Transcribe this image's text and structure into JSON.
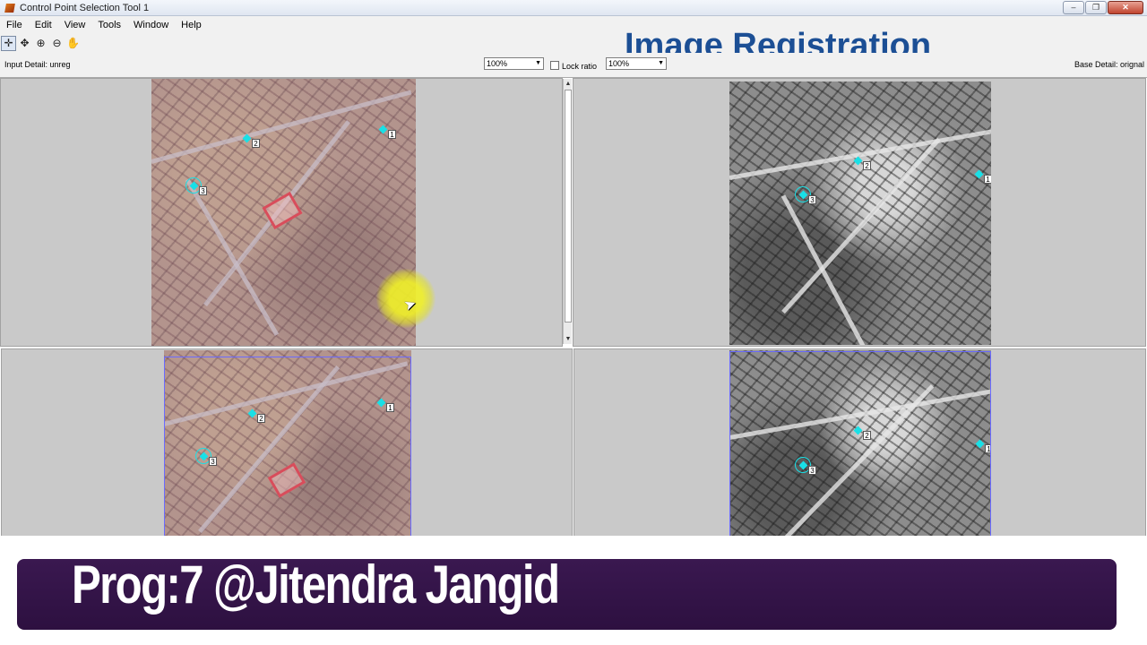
{
  "window": {
    "title": "Control Point Selection Tool 1",
    "minimize": "–",
    "maximize": "❐",
    "close": "✕"
  },
  "menu": [
    "File",
    "Edit",
    "View",
    "Tools",
    "Window",
    "Help"
  ],
  "toolbar": {
    "tools": [
      {
        "icon": "add-point-icon",
        "glyph": "✛"
      },
      {
        "icon": "edit-point-icon",
        "glyph": "✥"
      },
      {
        "icon": "zoom-in-icon",
        "glyph": "⊕"
      },
      {
        "icon": "zoom-out-icon",
        "glyph": "⊖"
      },
      {
        "icon": "pan-hand-icon",
        "glyph": "✋"
      }
    ]
  },
  "heading": "Image Registration",
  "details": {
    "input_detail": "Input Detail: unreg",
    "base_detail": "Base Detail: orignal",
    "input_zoom": "100%",
    "base_zoom": "100%",
    "lock_ratio": "Lock ratio"
  },
  "control_points": [
    "1",
    "2",
    "3"
  ],
  "banner": {
    "text": "Prog:7 @Jitendra Jangid"
  },
  "colors": {
    "heading": "#1c4f95",
    "control_point": "#19e0e6",
    "banner_bg": "#3a1850"
  }
}
